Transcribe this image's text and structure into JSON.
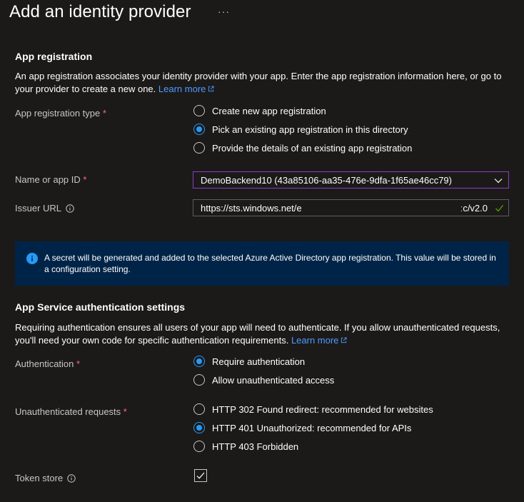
{
  "header": {
    "title": "Add an identity provider",
    "more": "···"
  },
  "app_registration": {
    "section_title": "App registration",
    "description": "An app registration associates your identity provider with your app. Enter the app registration information here, or go to your provider to create a new one.",
    "learn_more": "Learn more",
    "type_label": "App registration type",
    "type_options": [
      {
        "label": "Create new app registration",
        "checked": false
      },
      {
        "label": "Pick an existing app registration in this directory",
        "checked": true
      },
      {
        "label": "Provide the details of an existing app registration",
        "checked": false
      }
    ],
    "name_label": "Name or app ID",
    "name_value": "DemoBackend10 (43a85106-aa35-476e-9dfa-1f65ae46cc79)",
    "issuer_label": "Issuer URL",
    "issuer_value_start": "https://sts.windows.net/e",
    "issuer_value_end": "ːc/v2.0",
    "info_message": "A secret will be generated and added to the selected Azure Active Directory app registration. This value will be stored in a configuration setting."
  },
  "auth_settings": {
    "section_title": "App Service authentication settings",
    "description": "Requiring authentication ensures all users of your app will need to authenticate. If you allow unauthenticated requests, you'll need your own code for specific authentication requirements.",
    "learn_more": "Learn more",
    "auth_label": "Authentication",
    "auth_options": [
      {
        "label": "Require authentication",
        "checked": true
      },
      {
        "label": "Allow unauthenticated access",
        "checked": false
      }
    ],
    "unauth_label": "Unauthenticated requests",
    "unauth_options": [
      {
        "label": "HTTP 302 Found redirect: recommended for websites",
        "checked": false
      },
      {
        "label": "HTTP 401 Unauthorized: recommended for APIs",
        "checked": true
      },
      {
        "label": "HTTP 403 Forbidden",
        "checked": false
      }
    ],
    "token_store_label": "Token store",
    "token_store_checked": true
  },
  "required_marker": "*",
  "colors": {
    "accent": "#2899f5",
    "link": "#4f9bff",
    "required": "#f1707b",
    "info_bg": "#002448",
    "focus_border": "#8a3ec4",
    "valid": "#57a300"
  }
}
